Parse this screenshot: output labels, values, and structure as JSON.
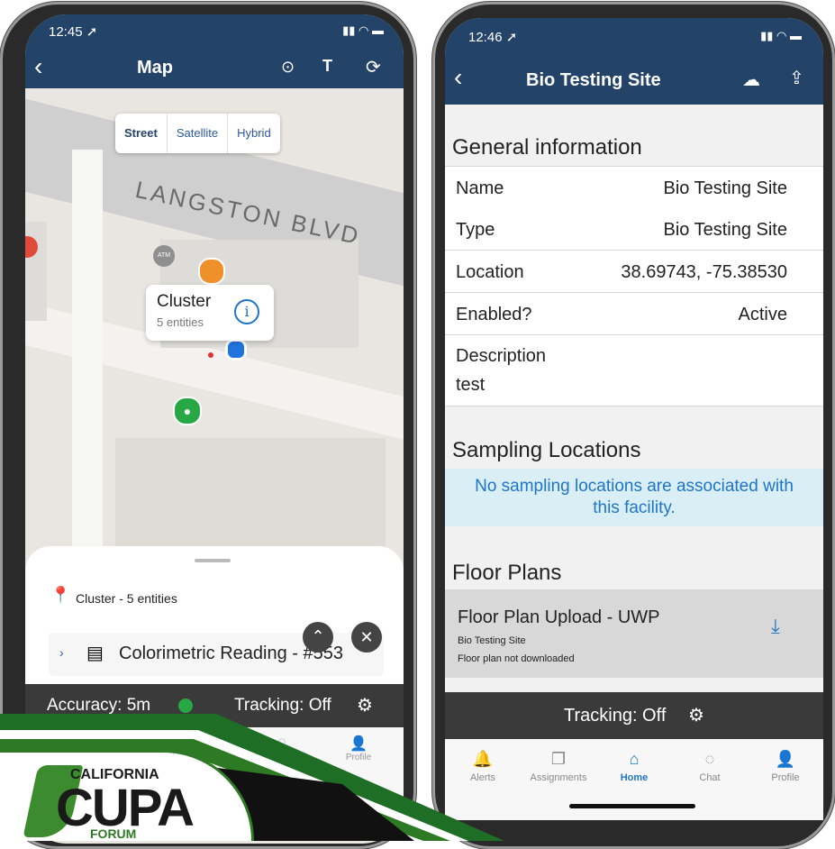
{
  "left": {
    "status": {
      "time": "12:45 ➚",
      "icons": "..ıl ᯤ ▬"
    },
    "nav": {
      "title": "Map",
      "back": "‹"
    },
    "map_types": [
      "Street",
      "Satellite",
      "Hybrid"
    ],
    "street_label": "LANGSTON BLVD",
    "atm_label": "ATM",
    "callout": {
      "title": "Cluster",
      "subtitle": "5 entities"
    },
    "sheet": {
      "cluster_label": "Cluster - 5 entities",
      "item_label": "Colorimetric Reading - #553"
    },
    "bottom": {
      "accuracy": "Accuracy: 5m",
      "tracking": "Tracking: Off"
    },
    "tabs": [
      "Profile"
    ]
  },
  "right": {
    "status": {
      "time": "12:46 ➚"
    },
    "nav": {
      "title": "Bio Testing Site",
      "back": "‹"
    },
    "general": {
      "heading": "General information",
      "rows": [
        {
          "key": "Name",
          "value": "Bio Testing Site"
        },
        {
          "key": "Type",
          "value": "Bio Testing Site"
        },
        {
          "key": "Location",
          "value": "38.69743, -75.38530"
        },
        {
          "key": "Enabled?",
          "value": "Active"
        }
      ],
      "description_label": "Description",
      "description_value": "test"
    },
    "sampling": {
      "heading": "Sampling Locations",
      "message": "No sampling locations are associated with this facility."
    },
    "floor": {
      "heading": "Floor Plans",
      "title": "Floor Plan Upload - UWP",
      "site": "Bio Testing Site",
      "status": "Floor plan not downloaded"
    },
    "tracking": "Tracking:  Off",
    "tabs": [
      "Alerts",
      "Assignments",
      "Home",
      "Chat",
      "Profile"
    ]
  },
  "logo": {
    "line1": "CALIFORNIA",
    "line2": "CUPA",
    "line3": "FORUM"
  },
  "colors": {
    "nav": "#234468",
    "accent": "#1f74c7",
    "banner": "#d9eff5",
    "logo_green": "#2e7a24"
  }
}
